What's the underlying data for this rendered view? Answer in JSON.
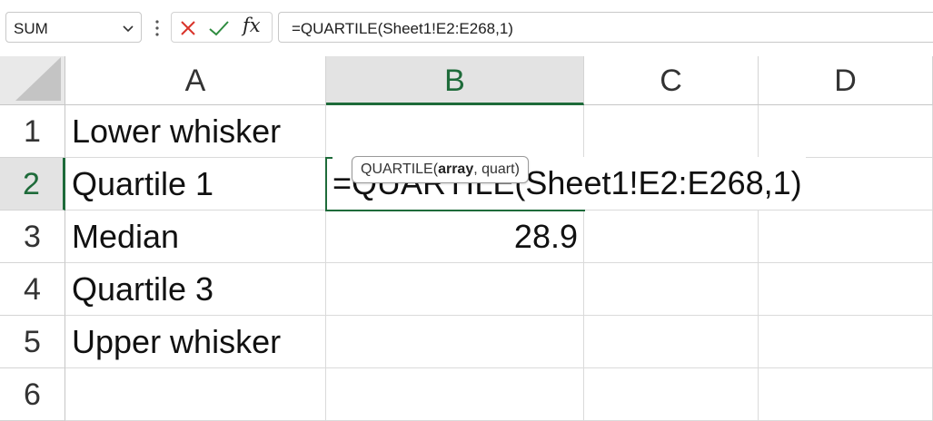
{
  "formula_bar": {
    "name_box": "SUM",
    "fx_label": "fx",
    "formula": "=QUARTILE(Sheet1!E2:E268,1)"
  },
  "columns": [
    "A",
    "B",
    "C",
    "D"
  ],
  "rows": [
    "1",
    "2",
    "3",
    "4",
    "5",
    "6"
  ],
  "cells": {
    "A1": "Lower whisker",
    "A2": "Quartile 1",
    "A3": "Median",
    "A4": "Quartile 3",
    "A5": "Upper whisker",
    "B3": "28.9"
  },
  "editing": {
    "cell": "B2",
    "text": "=QUARTILE(Sheet1!E2:E268,1)"
  },
  "tooltip": {
    "func": "QUARTILE(",
    "arg1": "array",
    "rest": ", quart)"
  },
  "colors": {
    "accent": "#1e6b3a",
    "cancel": "#d9342b",
    "enter": "#2e8b3f"
  }
}
